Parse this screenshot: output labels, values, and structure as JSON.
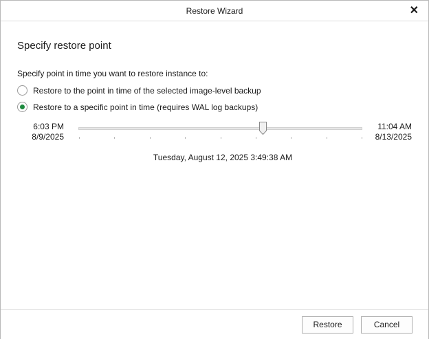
{
  "window": {
    "title": "Restore Wizard",
    "close_icon": "close-icon"
  },
  "page": {
    "heading": "Specify restore point",
    "prompt": "Specify point in time you want to restore instance to:"
  },
  "options": [
    {
      "label": "Restore to the point in time of the selected image-level backup",
      "selected": false
    },
    {
      "label": "Restore to a specific point in time (requires WAL log backups)",
      "selected": true
    }
  ],
  "slider": {
    "start_time": "6:03 PM",
    "start_date": "8/9/2025",
    "end_time": "11:04 AM",
    "end_date": "8/13/2025",
    "position_fraction": 0.65,
    "tick_count": 9,
    "selected_value": "Tuesday, August 12, 2025 3:49:38 AM"
  },
  "buttons": {
    "restore": "Restore",
    "cancel": "Cancel"
  },
  "colors": {
    "radio_selected": "#1d8a3f"
  }
}
